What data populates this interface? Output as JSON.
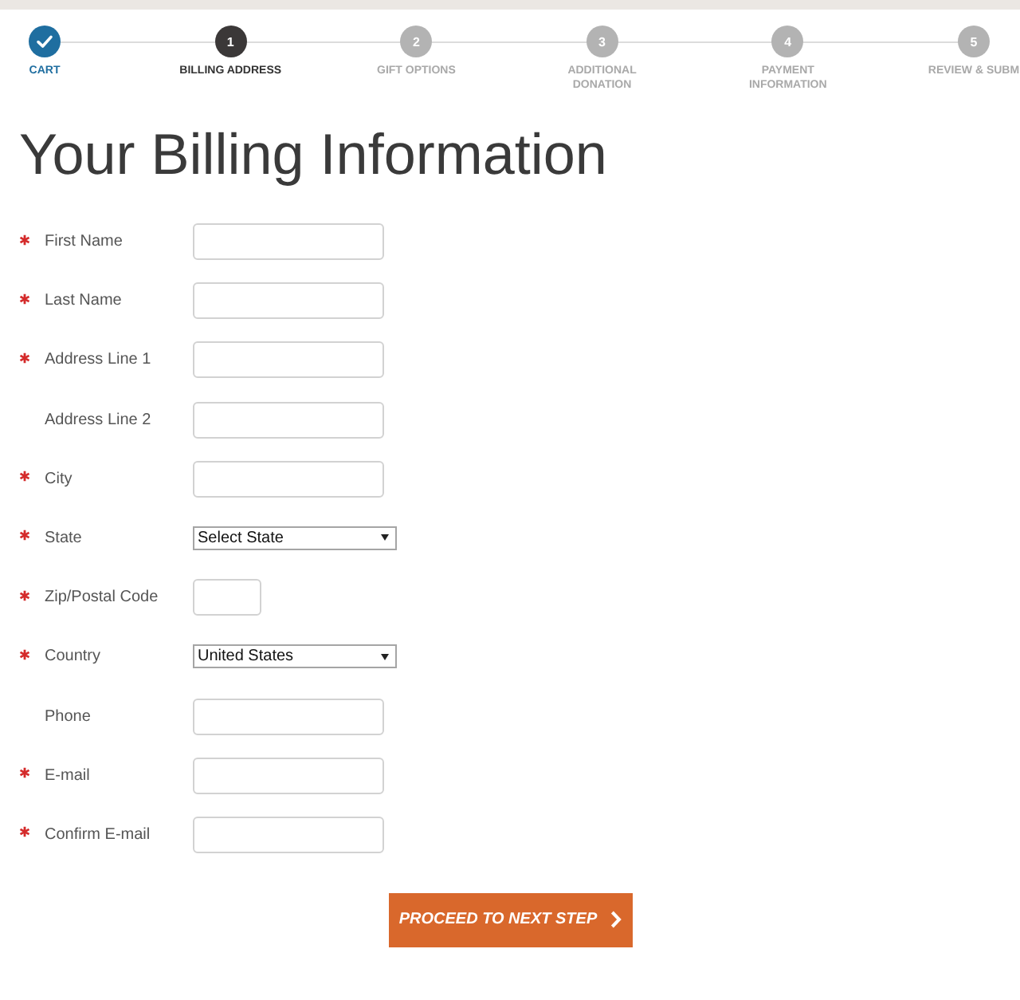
{
  "progress_steps": [
    {
      "label": "CART",
      "completed": true,
      "selected": false
    },
    {
      "number": "1",
      "label": "BILLING ADDRESS",
      "completed": false,
      "selected": true
    },
    {
      "number": "2",
      "label": "GIFT OPTIONS",
      "completed": false,
      "selected": false
    },
    {
      "number": "3",
      "label": "ADDITIONAL DONATION",
      "completed": false,
      "selected": false
    },
    {
      "number": "4",
      "label": "PAYMENT INFORMATION",
      "completed": false,
      "selected": false
    },
    {
      "number": "5",
      "label": "REVIEW & SUBM",
      "completed": false,
      "selected": false
    }
  ],
  "title": "Your Billing Information",
  "fields": [
    {
      "label": "First Name",
      "required": true,
      "kind": "text"
    },
    {
      "label": "Last Name",
      "required": true,
      "kind": "text"
    },
    {
      "label": "Address Line 1",
      "required": true,
      "kind": "text"
    },
    {
      "label": "Address Line 2",
      "required": false,
      "kind": "text"
    },
    {
      "label": "City",
      "required": true,
      "kind": "text"
    },
    {
      "label": "State",
      "required": true,
      "kind": "select",
      "value": "Select State"
    },
    {
      "label": "Zip/Postal Code",
      "required": true,
      "kind": "zip"
    },
    {
      "label": "Country",
      "required": true,
      "kind": "select",
      "value": "United States"
    },
    {
      "label": "Phone",
      "required": false,
      "kind": "text"
    },
    {
      "label": "E-mail",
      "required": true,
      "kind": "text"
    },
    {
      "label": "Confirm E-mail",
      "required": true,
      "kind": "text"
    }
  ],
  "button": {
    "label": "PROCEED TO NEXT STEP"
  }
}
